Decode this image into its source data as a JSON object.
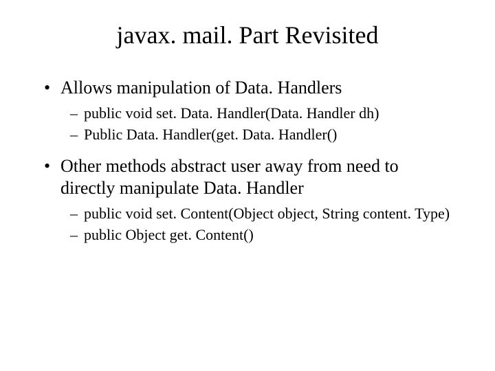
{
  "title": "javax. mail. Part Revisited",
  "bullets": [
    {
      "text": "Allows manipulation of Data. Handlers",
      "sub": [
        "public void set. Data. Handler(Data. Handler dh)",
        "Public Data. Handler(get. Data. Handler()"
      ]
    },
    {
      "text": "Other methods abstract user away from need to directly manipulate Data. Handler",
      "sub": [
        "public void set. Content(Object object, String content. Type)",
        "public Object get. Content()"
      ]
    }
  ]
}
